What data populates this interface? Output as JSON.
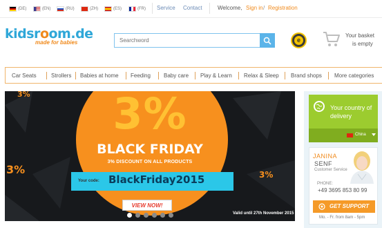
{
  "topbar": {
    "languages": [
      {
        "code": "(DE)",
        "flag": "de"
      },
      {
        "code": "(EN)",
        "flag": "en"
      },
      {
        "code": "(RU)",
        "flag": "ru"
      },
      {
        "code": "(ZH)",
        "flag": "zh"
      },
      {
        "code": "(ES)",
        "flag": "es"
      },
      {
        "code": "(FR)",
        "flag": "fr"
      }
    ],
    "service": "Service",
    "contact": "Contact",
    "welcome": "Welcome,",
    "sign_in": "Sign in",
    "slash": "/",
    "registration": "Registration"
  },
  "header": {
    "logo_text_1": "kidsr",
    "logo_text_2": "o",
    "logo_text_3": "om.de",
    "logo_tagline": "made for babies",
    "search_placeholder": "Searchword",
    "trust_badge": "e",
    "basket_line1": "Your basket",
    "basket_line2": "is empty"
  },
  "nav": {
    "items": [
      "Car Seats",
      "Strollers",
      "Babies at home",
      "Feeding",
      "Baby care",
      "Play & Learn",
      "Relax & Sleep",
      "Brand shops",
      "More categories"
    ]
  },
  "banner": {
    "big_percent": "3%",
    "headline": "BLACK FRIDAY",
    "discount": "3% DISCOUNT ON ALL PRODUCTS",
    "code_label": "Your code:",
    "code": "BlackFriday2015",
    "cta": "VIEW NOW!",
    "valid": "Valid until 27th November 2015",
    "side_percent": "3%",
    "slides": 6,
    "active_slide": 1
  },
  "sidebar": {
    "country_title": "Your country of delivery",
    "country_selected": "China",
    "contact_first": "JANINA",
    "contact_last": "SENF",
    "contact_role": "Customer Service",
    "phone_label": "PHONE:",
    "phone": "+49 3695 853 80 99",
    "support_button": "GET SUPPORT",
    "hours": "Mo. - Fr. from 8am - 5pm"
  },
  "colors": {
    "accent_orange": "#f08a1c",
    "brand_blue": "#2fa7d8",
    "delivery_green": "#9ccc2f",
    "banner_dark": "#17191c",
    "code_band": "#2bc7e8"
  }
}
